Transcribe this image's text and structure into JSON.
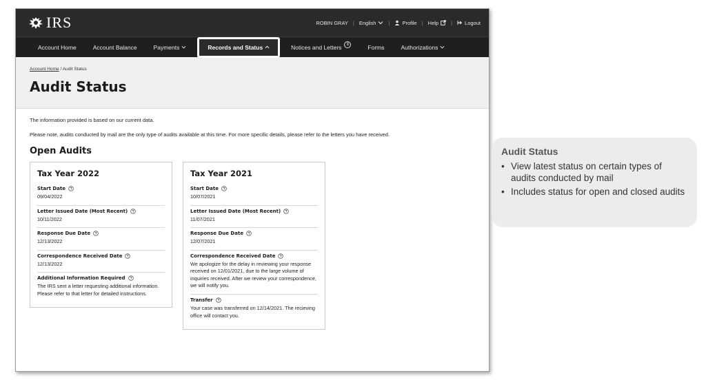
{
  "header": {
    "logo_text": "IRS",
    "user_name": "ROBIN GRAY",
    "language": "English",
    "profile": "Profile",
    "help": "Help",
    "logout": "Logout"
  },
  "nav": {
    "items": [
      {
        "label": "Account Home"
      },
      {
        "label": "Account Balance"
      },
      {
        "label": "Payments"
      },
      {
        "label": "Records and Status"
      },
      {
        "label": "Notices and Letters",
        "badge": "8"
      },
      {
        "label": "Forms"
      },
      {
        "label": "Authorizations"
      }
    ]
  },
  "breadcrumb": {
    "home": "Account Home",
    "separator": "/",
    "current": "Audit Status"
  },
  "page": {
    "title": "Audit Status",
    "intro1": "The information provided is based on our current data.",
    "intro2": "Please note, audits conducted by mail are the only type of audits available at this time. For more specific details, please refer to the letters you have received.",
    "section_title": "Open Audits"
  },
  "cards": [
    {
      "title": "Tax Year 2022",
      "fields": [
        {
          "label": "Start Date",
          "value": "09/04/2022"
        },
        {
          "label": "Letter Issued Date (Most Recent)",
          "value": "10/11/2022"
        },
        {
          "label": "Response Due Date",
          "value": "12/13/2022"
        },
        {
          "label": "Correspondence Received Date",
          "value": "12/13/2022"
        },
        {
          "label": "Additional Information Required",
          "value": "The IRS sent a letter requesting additional information. Please refer to that letter for detailed instructions."
        }
      ]
    },
    {
      "title": "Tax Year 2021",
      "fields": [
        {
          "label": "Start Date",
          "value": "10/07/2021"
        },
        {
          "label": "Letter Issued Date (Most Recent)",
          "value": "11/07/2021"
        },
        {
          "label": "Response Due Date",
          "value": "12/07/2021"
        },
        {
          "label": "Correspondence Received Date",
          "value": "We apologize for the delay in reviewing your response received on 12/01/2021, due to the large volume of inquiries received. After we review your correspondence, we will notify you."
        },
        {
          "label": "Transfer",
          "value": "Your case was transferred on 12/14/2021. The recieving office will contact you."
        }
      ]
    }
  ],
  "callout": {
    "title": "Audit Status",
    "bullets": [
      "View latest status on certain types of audits conducted by mail",
      "Includes status for open and closed audits"
    ]
  },
  "icons": {
    "logo": "eagle-icon",
    "profile": "user-icon",
    "help": "external-link-icon",
    "logout": "logout-icon",
    "field_help": "question-circle-icon",
    "dropdown": "chevron-down-icon",
    "active_dropdown": "chevron-up-icon"
  }
}
